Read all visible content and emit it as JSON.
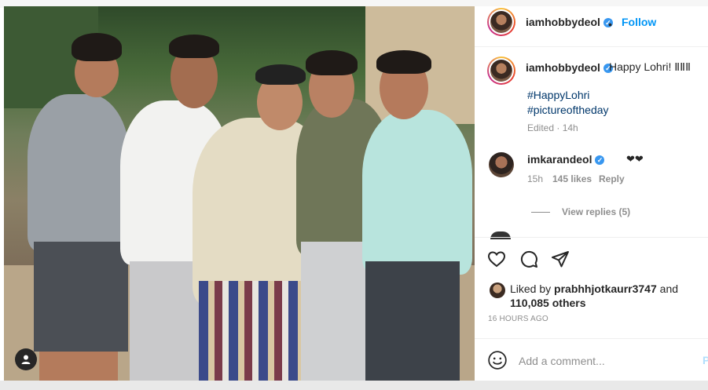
{
  "post": {
    "username": "iamhobbydeol",
    "follow_label": "Follow",
    "dot": "•",
    "caption": "Happy Lohri! ",
    "caption_emoji": "ⅡⅡⅡ",
    "hashtags": [
      "#HappyLohri",
      "#pictureoftheday"
    ],
    "edited": "Edited · 14h"
  },
  "comment": {
    "username": "imkarandeol",
    "text": "❤❤",
    "time": "15h",
    "likes": "145 likes",
    "reply": "Reply",
    "view_replies": "View replies (5)"
  },
  "likes": {
    "prefix": "Liked by ",
    "user": "prabhhjotkaurr3747",
    "middle": " and",
    "count": "110,085 others"
  },
  "timestamp": "16 HOURS AGO",
  "add_comment": {
    "placeholder": "Add a comment...",
    "post_label": "P"
  },
  "icons": [
    "heart-icon",
    "comment-icon",
    "share-icon",
    "emoji-icon",
    "user-tag-icon"
  ],
  "colors": {
    "link": "#00376b",
    "follow": "#0095f6",
    "verified": "#3897f0",
    "muted": "#8e8e8e"
  }
}
